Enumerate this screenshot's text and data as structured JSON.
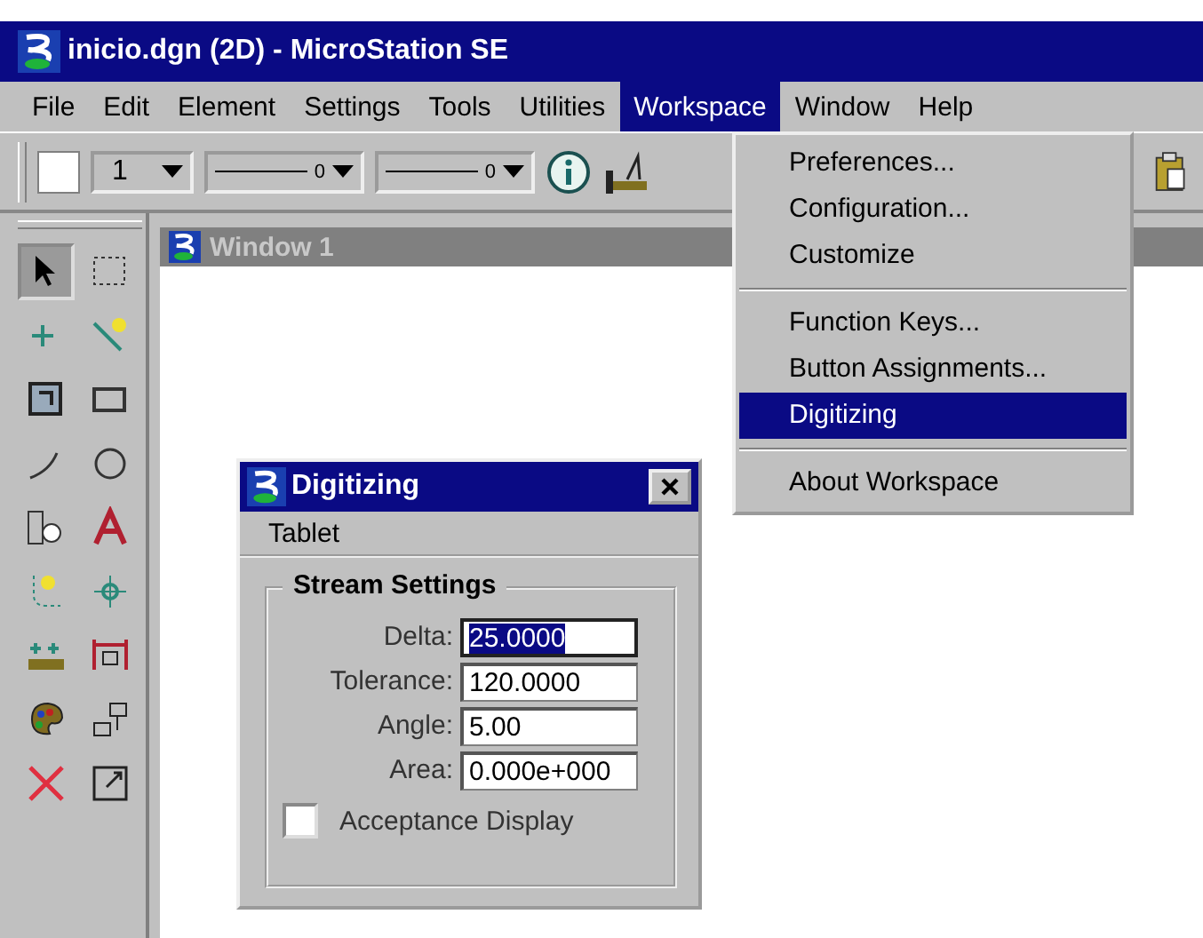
{
  "window": {
    "title": "inicio.dgn (2D) - MicroStation SE"
  },
  "menu_bar": [
    {
      "label": "File",
      "selected": false
    },
    {
      "label": "Edit",
      "selected": false
    },
    {
      "label": "Element",
      "selected": false
    },
    {
      "label": "Settings",
      "selected": false
    },
    {
      "label": "Tools",
      "selected": false
    },
    {
      "label": "Utilities",
      "selected": false
    },
    {
      "label": "Workspace",
      "selected": true
    },
    {
      "label": "Window",
      "selected": false
    },
    {
      "label": "Help",
      "selected": false
    }
  ],
  "toolbar": {
    "level": "1",
    "style": "0",
    "weight": "0"
  },
  "workspace_menu": [
    {
      "kind": "item",
      "label": "Preferences...",
      "selected": false
    },
    {
      "kind": "item",
      "label": "Configuration...",
      "selected": false
    },
    {
      "kind": "item",
      "label": "Customize",
      "selected": false
    },
    {
      "kind": "separator"
    },
    {
      "kind": "item",
      "label": "Function Keys...",
      "selected": false
    },
    {
      "kind": "item",
      "label": "Button Assignments...",
      "selected": false
    },
    {
      "kind": "item",
      "label": "Digitizing",
      "selected": true
    },
    {
      "kind": "separator"
    },
    {
      "kind": "item",
      "label": "About Workspace",
      "selected": false
    }
  ],
  "tool_palette": [
    {
      "selected": true
    },
    {
      "selected": false
    },
    {
      "selected": false
    },
    {
      "selected": false
    },
    {
      "selected": false
    },
    {
      "selected": false
    },
    {
      "selected": false
    },
    {
      "selected": false
    },
    {
      "selected": false
    },
    {
      "selected": false
    },
    {
      "selected": false
    },
    {
      "selected": false
    },
    {
      "selected": false
    },
    {
      "selected": false
    },
    {
      "selected": false
    },
    {
      "selected": false
    },
    {
      "selected": false
    },
    {
      "selected": false
    }
  ],
  "view_window": {
    "title": "Window 1"
  },
  "dialog": {
    "title": "Digitizing",
    "menu": "Tablet",
    "group": "Stream Settings",
    "fields": [
      {
        "label": "Delta:",
        "value": "25.0000",
        "focused": true
      },
      {
        "label": "Tolerance:",
        "value": "120.0000",
        "focused": false
      },
      {
        "label": "Angle:",
        "value": "5.00",
        "focused": false
      },
      {
        "label": "Area:",
        "value": "0.000e+000",
        "focused": false
      }
    ],
    "checkbox": {
      "label": "Acceptance Display",
      "checked": false
    }
  }
}
